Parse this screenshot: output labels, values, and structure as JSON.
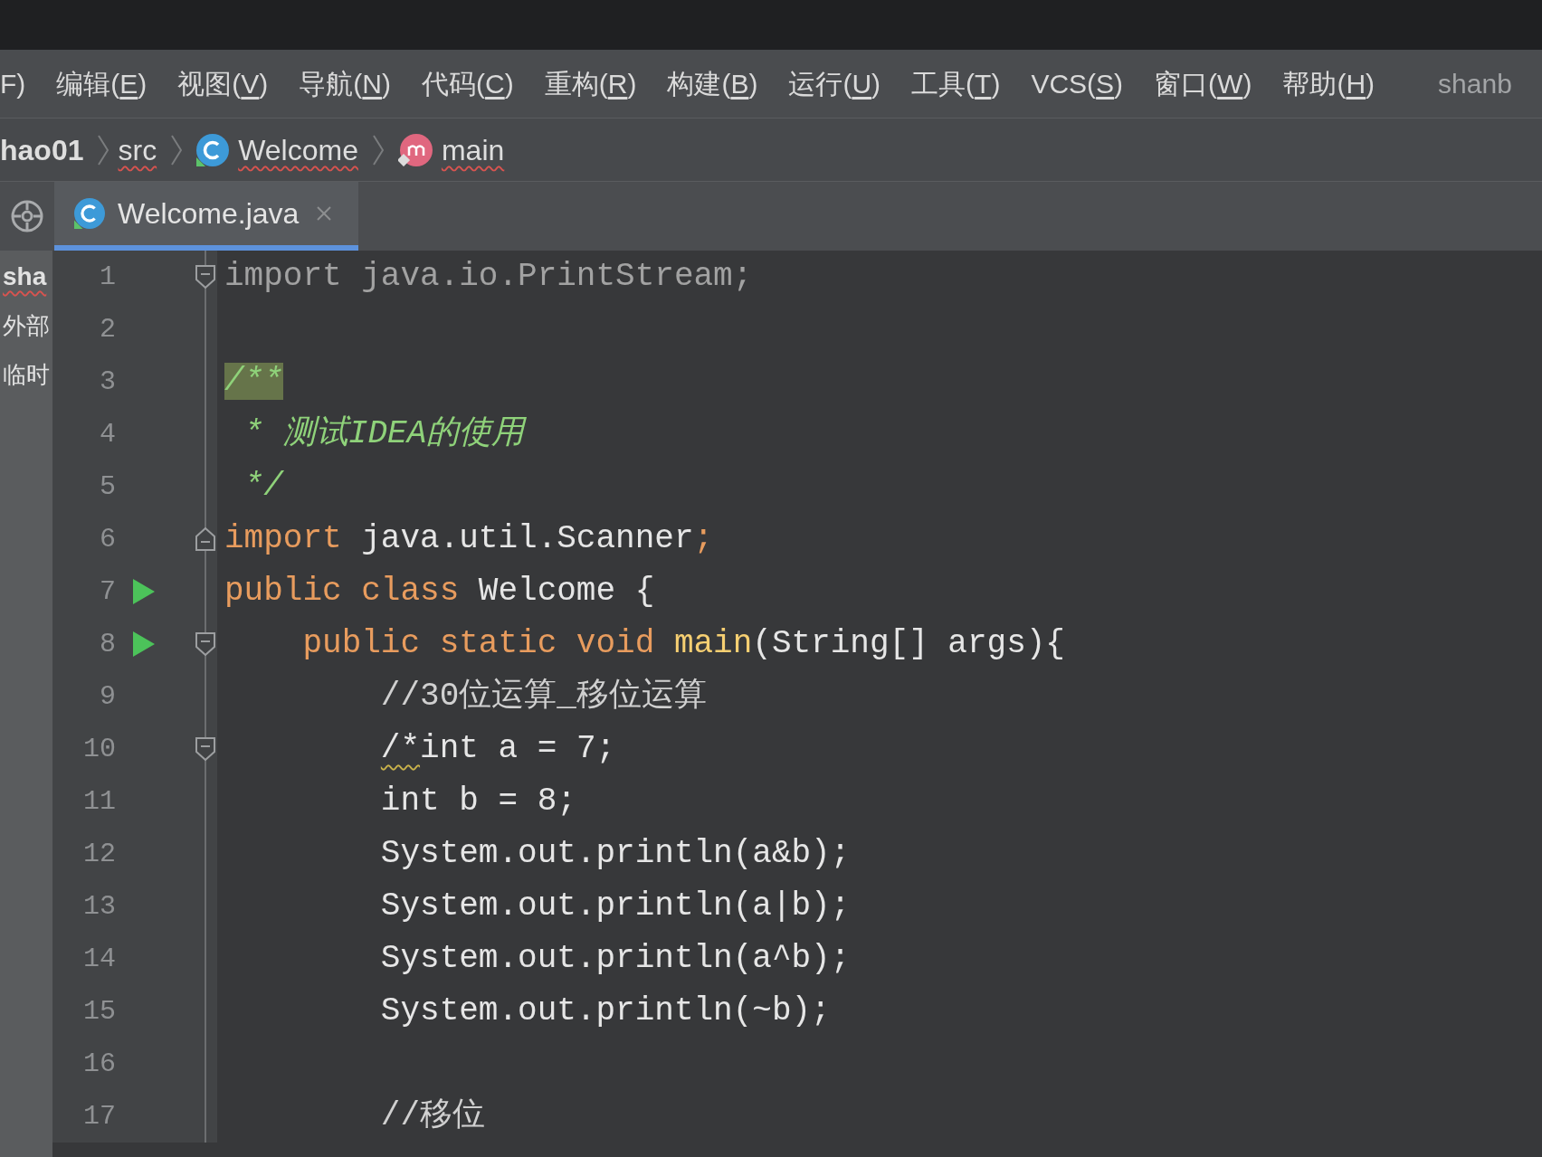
{
  "menu_bar": {
    "items": [
      "F)",
      "编辑(E)",
      "视图(V)",
      "导航(N)",
      "代码(C)",
      "重构(R)",
      "构建(B)",
      "运行(U)",
      "工具(T)",
      "VCS(S)",
      "窗口(W)",
      "帮助(H)"
    ],
    "project_title": "shanb"
  },
  "breadcrumbs": [
    {
      "label": "hao01",
      "kind": "module",
      "error": false
    },
    {
      "label": "src",
      "kind": "folder",
      "error": true
    },
    {
      "label": "Welcome",
      "kind": "class",
      "error": true
    },
    {
      "label": "main",
      "kind": "method",
      "error": true
    }
  ],
  "tabs": [
    {
      "label": "Welcome.java",
      "selected": true
    }
  ],
  "project_panel": {
    "items": [
      {
        "label": "sha",
        "error": true
      },
      {
        "label": "外部",
        "error": false
      },
      {
        "label": "临时",
        "error": false
      }
    ]
  },
  "editor": {
    "lines": [
      {
        "number": "1",
        "run": false,
        "fold_start": true,
        "fold_end": false,
        "tokens": [
          {
            "text": "import java.io.PrintStream;",
            "kind": "unused"
          }
        ]
      },
      {
        "number": "2",
        "run": false,
        "fold_start": false,
        "fold_end": false
      },
      {
        "number": "3",
        "run": false,
        "fold_start": false,
        "fold_end": false,
        "tokens": [
          {
            "text": "/**",
            "kind": "doc-match"
          }
        ]
      },
      {
        "number": "4",
        "run": false,
        "fold_start": false,
        "fold_end": false,
        "tokens": [
          {
            "text": " * 测试IDEA的使用",
            "kind": "doc"
          }
        ]
      },
      {
        "number": "5",
        "run": false,
        "fold_start": false,
        "fold_end": false,
        "tokens": [
          {
            "text": " */",
            "kind": "doc"
          }
        ]
      },
      {
        "number": "6",
        "run": false,
        "fold_start": false,
        "fold_end": true,
        "tokens": [
          {
            "text": "import",
            "kind": "keyword"
          },
          {
            "text": " java.util.Scanner",
            "kind": "plain"
          },
          {
            "text": ";",
            "kind": "keyword"
          }
        ]
      },
      {
        "number": "7",
        "run": true,
        "fold_start": false,
        "fold_end": false,
        "tokens": [
          {
            "text": "public class",
            "kind": "keyword"
          },
          {
            "text": " Welcome {",
            "kind": "plain"
          }
        ]
      },
      {
        "number": "8",
        "run": true,
        "fold_start": true,
        "fold_end": false,
        "tokens": [
          {
            "text": "    public static void ",
            "kind": "keyword"
          },
          {
            "text": "main",
            "kind": "method"
          },
          {
            "text": "(String[] args){",
            "kind": "plain"
          }
        ]
      },
      {
        "number": "9",
        "run": false,
        "fold_start": false,
        "fold_end": false,
        "tokens": [
          {
            "text": "        //30位运算_移位运算",
            "kind": "comment"
          }
        ]
      },
      {
        "number": "10",
        "run": false,
        "fold_start": true,
        "fold_end": false,
        "tokens": [
          {
            "text": "        /*",
            "kind": "warning"
          },
          {
            "text": "int a = 7;",
            "kind": "plain"
          }
        ]
      },
      {
        "number": "11",
        "run": false,
        "fold_start": false,
        "fold_end": false,
        "tokens": [
          {
            "text": "        int b = 8;",
            "kind": "plain"
          }
        ]
      },
      {
        "number": "12",
        "run": false,
        "fold_start": false,
        "fold_end": false,
        "tokens": [
          {
            "text": "        System.out.println(a&b);",
            "kind": "plain"
          }
        ]
      },
      {
        "number": "13",
        "run": false,
        "fold_start": false,
        "fold_end": false,
        "tokens": [
          {
            "text": "        System.out.println(a|b);",
            "kind": "plain"
          }
        ]
      },
      {
        "number": "14",
        "run": false,
        "fold_start": false,
        "fold_end": false,
        "tokens": [
          {
            "text": "        System.out.println(a^b);",
            "kind": "plain"
          }
        ]
      },
      {
        "number": "15",
        "run": false,
        "fold_start": false,
        "fold_end": false,
        "tokens": [
          {
            "text": "        System.out.println(~b);",
            "kind": "plain"
          }
        ]
      },
      {
        "number": "16",
        "run": false,
        "fold_start": false,
        "fold_end": false
      },
      {
        "number": "17",
        "run": false,
        "fold_start": false,
        "fold_end": false,
        "tokens": [
          {
            "text": "        //移位",
            "kind": "comment"
          }
        ]
      }
    ]
  }
}
